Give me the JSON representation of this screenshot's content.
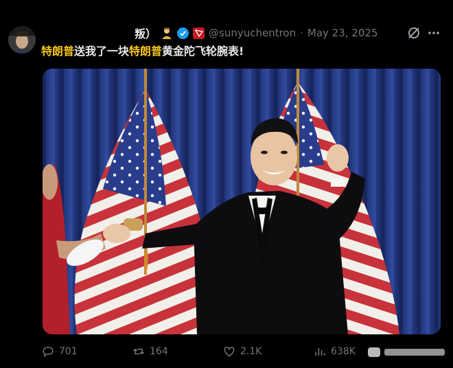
{
  "tweet": {
    "author_name_fragment": "叛）",
    "handle": "@sunyuchentron",
    "separator": "·",
    "date": "May 23, 2025",
    "text_parts": [
      {
        "text": "特朗普",
        "highlight": true
      },
      {
        "text": "送我了一块",
        "highlight": false
      },
      {
        "text": "特朗普",
        "highlight": true
      },
      {
        "text": "黄金陀飞轮腕表!",
        "highlight": false
      }
    ]
  },
  "icons": {
    "avatar": "avatar",
    "emoji_badge": "person-emoji-icon",
    "verified": "verified-badge-icon",
    "tron": "tron-logo-icon",
    "grok": "grok-icon",
    "more": "more-icon",
    "reply": "reply-icon",
    "retweet": "retweet-icon",
    "like": "like-icon",
    "views": "views-icon"
  },
  "actions": {
    "replies": "701",
    "retweets": "164",
    "likes": "2.1K",
    "views": "638K"
  },
  "colors": {
    "background": "#000000",
    "text": "#e7e9ea",
    "muted": "#71767b",
    "verified": "#1d9bf0",
    "tron": "#c21a24",
    "highlight": "#f5c518"
  }
}
